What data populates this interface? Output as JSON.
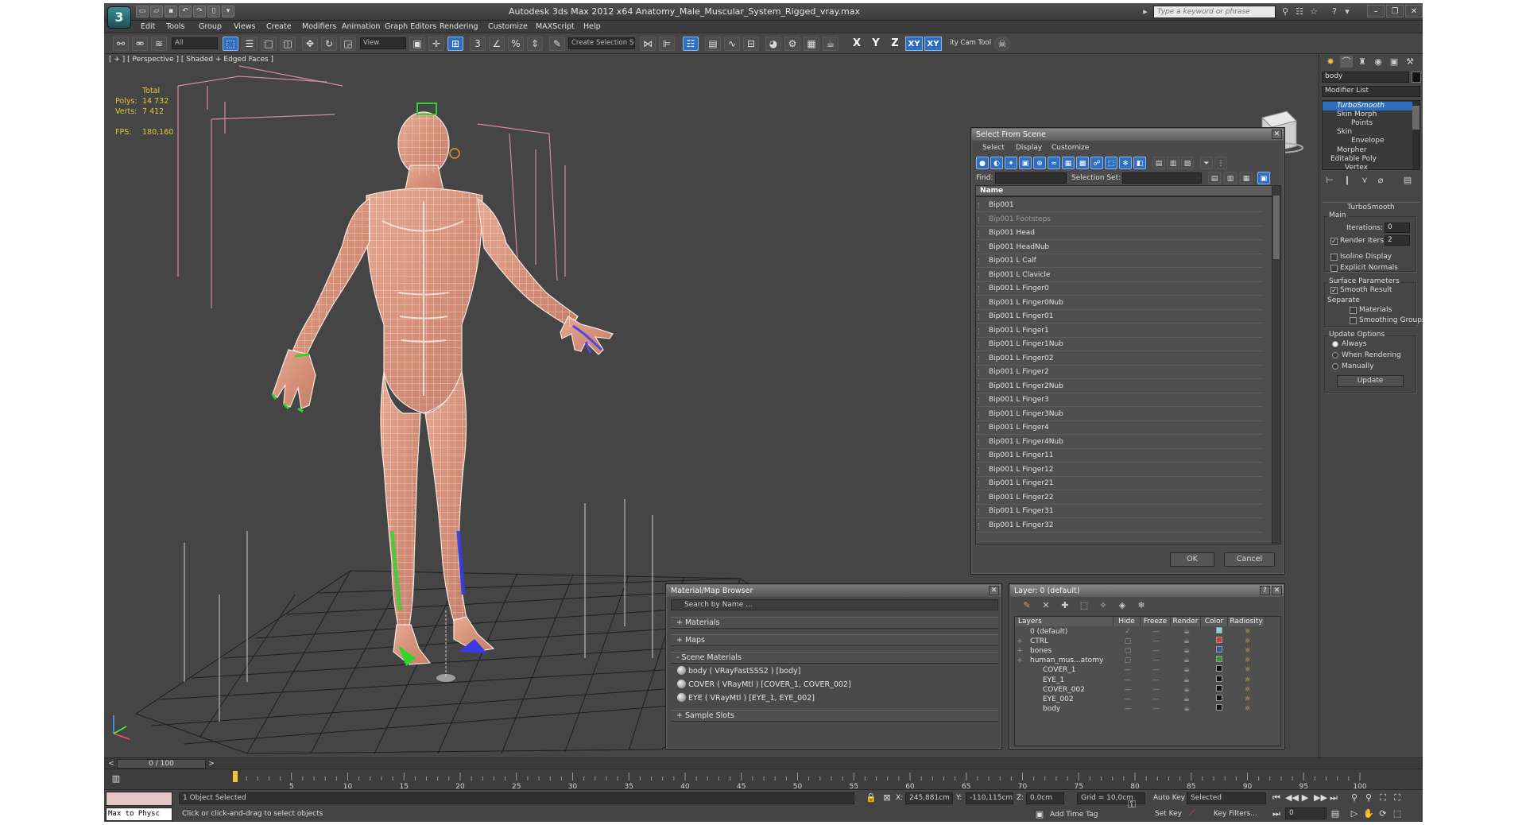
{
  "app": {
    "logo": "3",
    "title": "Autodesk 3ds Max  2012 x64      Anatomy_Male_Muscular_System_Rigged_vray.max",
    "search_placeholder": "Type a keyword or phrase"
  },
  "menu": [
    "Edit",
    "Tools",
    "Group",
    "Views",
    "Create",
    "Modifiers",
    "Animation",
    "Graph Editors",
    "Rendering",
    "Customize",
    "MAXScript",
    "Help"
  ],
  "toolbar": {
    "selection_filter": "All",
    "reference_coord": "View",
    "named_selection": "Create Selection Se",
    "axes": [
      "X",
      "Y",
      "Z",
      "XY",
      "XY"
    ],
    "cam_tool_label": "ity Cam Tool \\"
  },
  "viewport": {
    "label": "[ + ] [ Perspective ] [ Shaded + Edged Faces ]",
    "stats": {
      "total_label": "Total",
      "polys_label": "Polys:",
      "polys_value": "14 732",
      "verts_label": "Verts:",
      "verts_value": "7 412",
      "fps_label": "FPS:",
      "fps_value": "180,160"
    }
  },
  "select_from_scene": {
    "title": "Select From Scene",
    "menus": [
      "Select",
      "Display",
      "Customize"
    ],
    "find_label": "Find:",
    "selection_set_label": "Selection Set:",
    "name_header": "Name",
    "items": [
      "Bip001",
      "Bip001 Footsteps",
      "Bip001 Head",
      "Bip001 HeadNub",
      "Bip001 L Calf",
      "Bip001 L Clavicle",
      "Bip001 L Finger0",
      "Bip001 L Finger0Nub",
      "Bip001 L Finger01",
      "Bip001 L Finger1",
      "Bip001 L Finger1Nub",
      "Bip001 L Finger02",
      "Bip001 L Finger2",
      "Bip001 L Finger2Nub",
      "Bip001 L Finger3",
      "Bip001 L Finger3Nub",
      "Bip001 L Finger4",
      "Bip001 L Finger4Nub",
      "Bip001 L Finger11",
      "Bip001 L Finger12",
      "Bip001 L Finger21",
      "Bip001 L Finger22",
      "Bip001 L Finger31",
      "Bip001 L Finger32"
    ],
    "ok": "OK",
    "cancel": "Cancel"
  },
  "material_browser": {
    "title": "Material/Map Browser",
    "search_placeholder": "Search by Name ...",
    "sections": {
      "materials": "+ Materials",
      "maps": "+ Maps",
      "scene": "- Scene Materials",
      "slots": "+ Sample Slots"
    },
    "scene_materials": [
      "body  ( VRayFastSSS2 ) [body]",
      "COVER  ( VRayMtl ) [COVER_1, COVER_002]",
      "EYE  ( VRayMtl ) [EYE_1, EYE_002]"
    ]
  },
  "layer_manager": {
    "title": "Layer: 0 (default)",
    "headers": [
      "Layers",
      "Hide",
      "Freeze",
      "Render",
      "Color",
      "Radiosity"
    ],
    "layers": [
      {
        "name": "0 (default)",
        "color": "#8ad6d6"
      },
      {
        "name": "CTRL",
        "color": "#d83a3a"
      },
      {
        "name": "bones",
        "color": "#2d5aa8"
      },
      {
        "name": "human_mus...atomy",
        "color": "#2c9a2c"
      },
      {
        "name": "COVER_1",
        "color": "#111111"
      },
      {
        "name": "EYE_1",
        "color": "#111111"
      },
      {
        "name": "COVER_002",
        "color": "#111111"
      },
      {
        "name": "EYE_002",
        "color": "#111111"
      },
      {
        "name": "body",
        "color": "#111111"
      }
    ]
  },
  "command_panel": {
    "object_name": "body",
    "modifier_list": "Modifier List",
    "stack": [
      "TurboSmooth",
      "Skin Morph",
      "Points",
      "Skin",
      "Envelope",
      "Morpher",
      "Editable Poly",
      "Vertex"
    ],
    "rollout_title": "TurboSmooth",
    "main_label": "Main",
    "iterations_label": "Iterations:",
    "iterations_value": "0",
    "render_iters_label": "Render Iters:",
    "render_iters_value": "2",
    "isoline": "Isoline Display",
    "explicit_normals": "Explicit Normals",
    "surface_params": "Surface Parameters",
    "smooth_result": "Smooth Result",
    "separate": "Separate",
    "materials": "Materials",
    "smoothing_groups": "Smoothing Groups",
    "update_options": "Update Options",
    "always": "Always",
    "when_rendering": "When Rendering",
    "manually": "Manually",
    "update_button": "Update"
  },
  "timeline": {
    "frame_indicator": "0 / 100",
    "ticks": [
      "0",
      "5",
      "10",
      "15",
      "20",
      "25",
      "30",
      "35",
      "40",
      "45",
      "50",
      "55",
      "60",
      "65",
      "70",
      "75",
      "80",
      "85",
      "90",
      "95",
      "100"
    ]
  },
  "status": {
    "maxscript": "Max to Physc",
    "selected": "1 Object Selected",
    "prompt": "Click or click-and-drag to select objects",
    "x_label": "X:",
    "x_value": "245,881cm",
    "y_label": "Y:",
    "y_value": "-110,115cm",
    "z_label": "Z:",
    "z_value": "0,0cm",
    "grid": "Grid = 10,0cm",
    "add_time_tag": "Add Time Tag",
    "auto_key": "Auto Key",
    "set_key": "Set Key",
    "selected_dropdown": "Selected",
    "key_filters": "Key Filters...",
    "frame_value": "0"
  }
}
